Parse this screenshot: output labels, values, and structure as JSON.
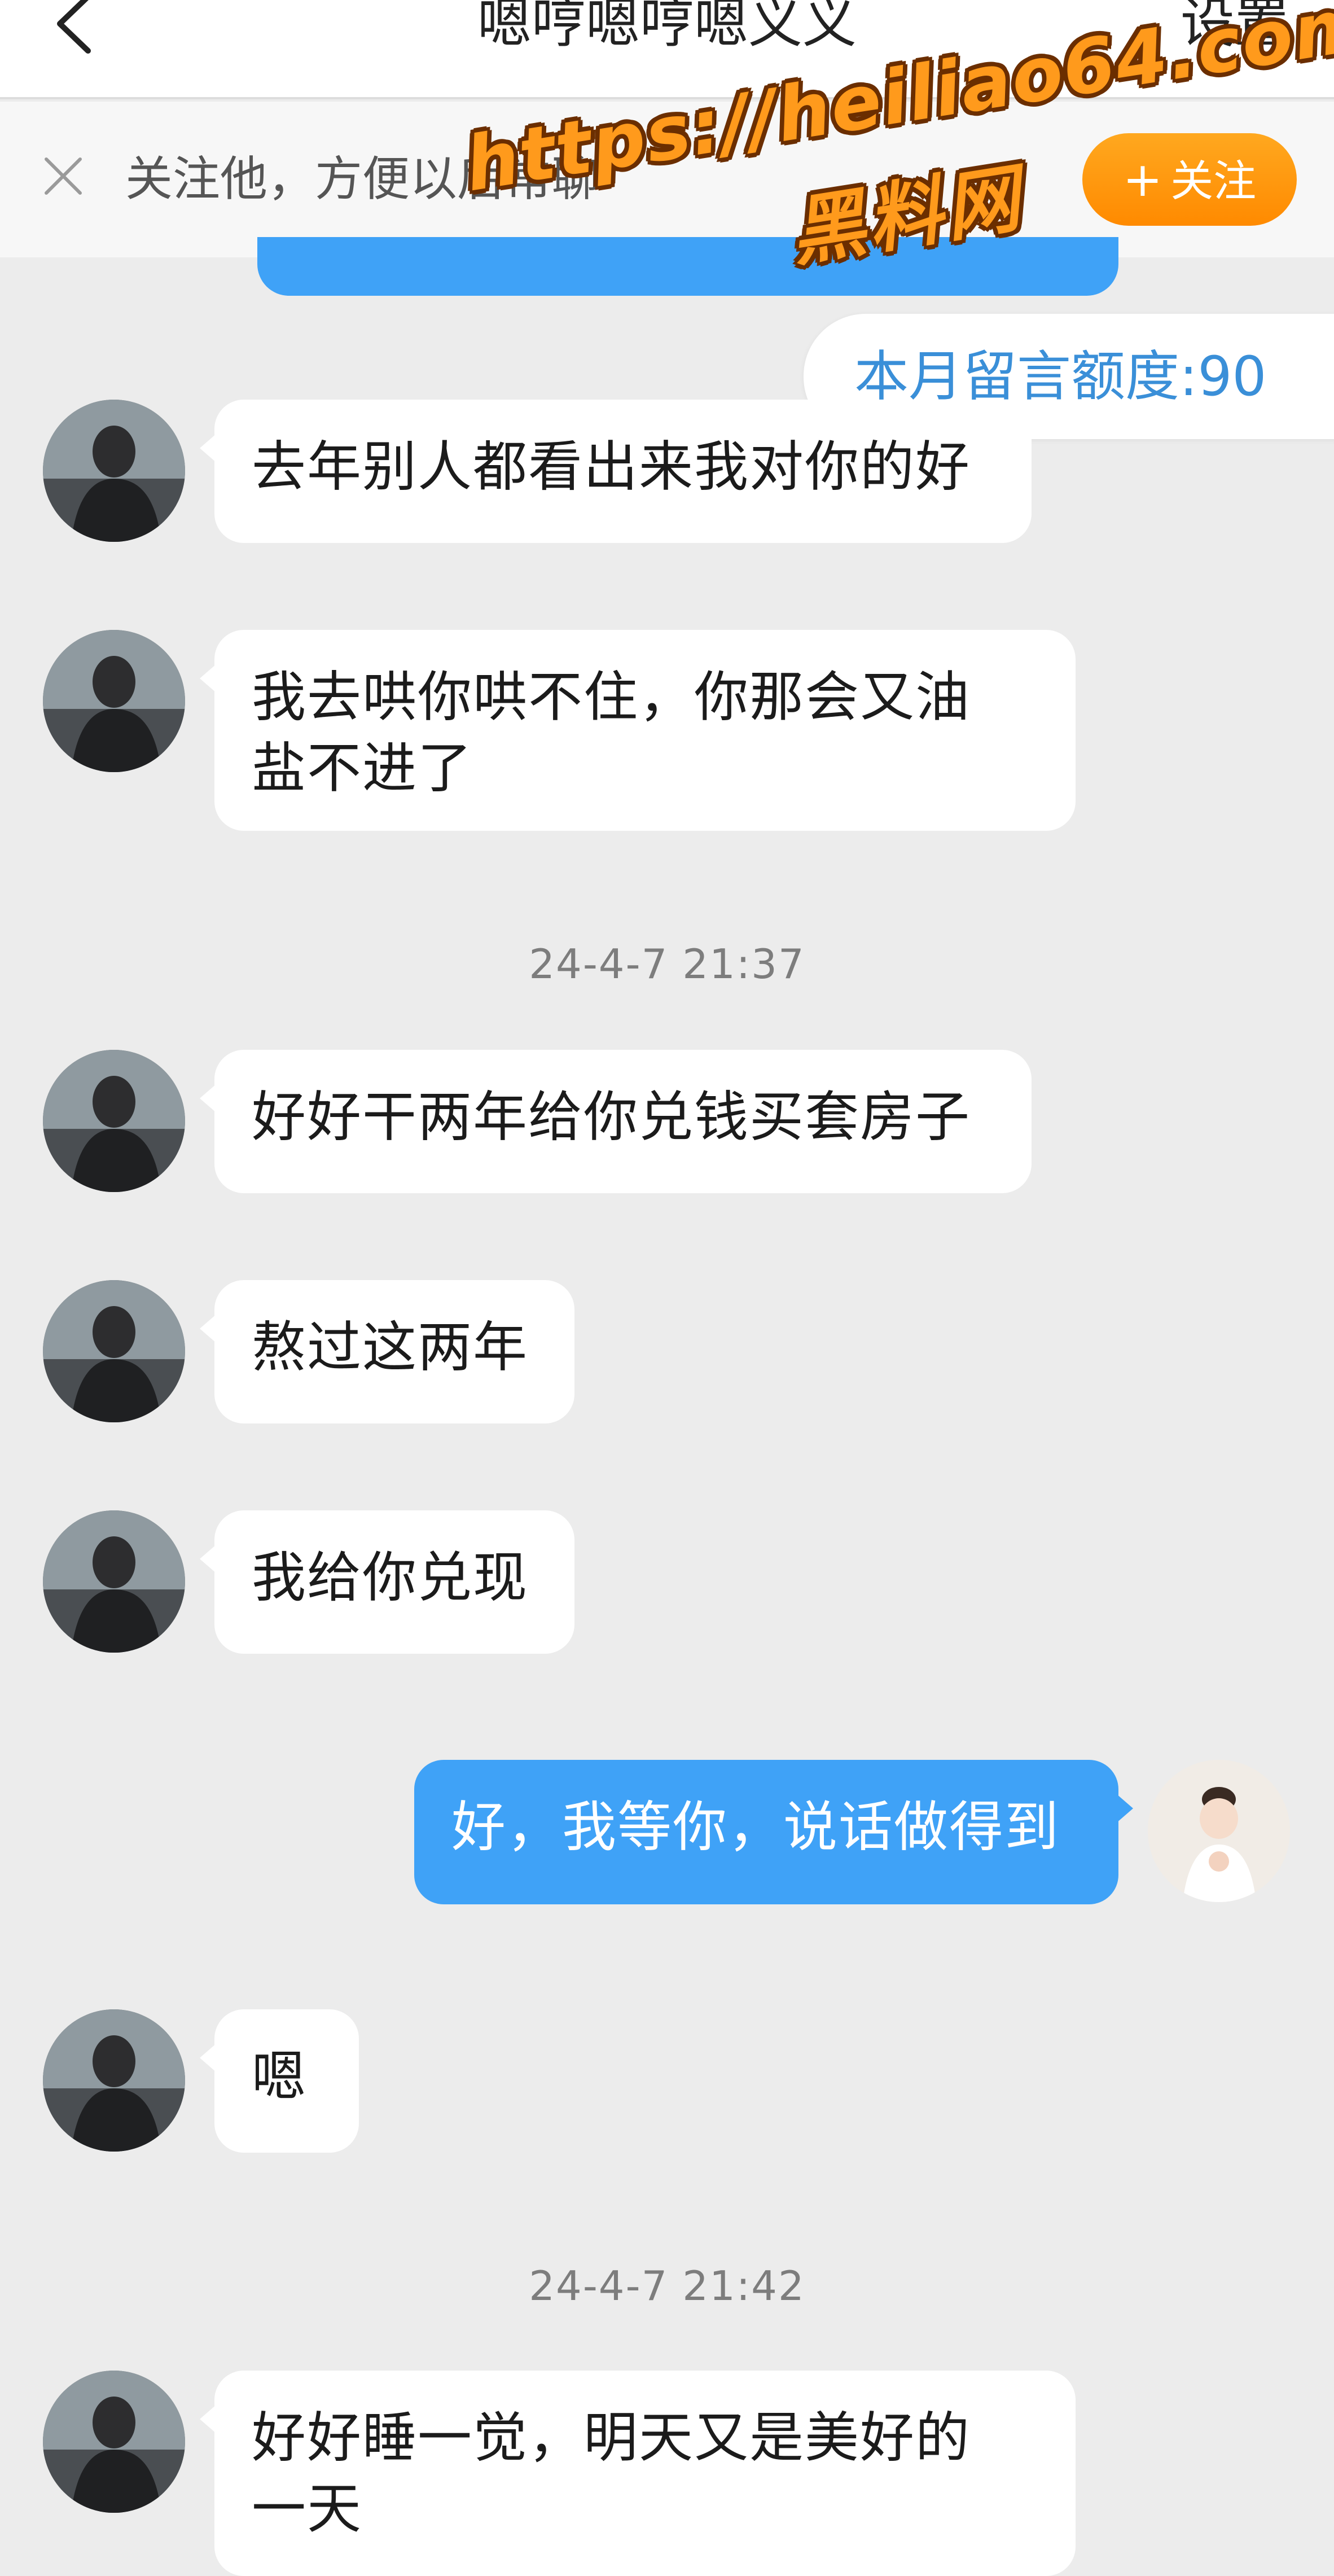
{
  "header": {
    "title": "嗯哼嗯哼嗯义义",
    "settings_label": "设置",
    "back_icon": "chevron-left-icon"
  },
  "follow_bar": {
    "text": "关注他，方便以后常聊",
    "button_label": "关注",
    "button_plus": "+",
    "close_icon": "close-icon"
  },
  "quota": {
    "text": "本月留言额度:90"
  },
  "messages": [
    {
      "side": "left",
      "text": "去年别人都看出来我对你的好"
    },
    {
      "side": "left",
      "line1": "我去哄你哄不住，你那会又油",
      "line2": "盐不进了"
    },
    {
      "type": "time",
      "text": "24-4-7 21:37"
    },
    {
      "side": "left",
      "text": "好好干两年给你兑钱买套房子"
    },
    {
      "side": "left",
      "text": "熬过这两年"
    },
    {
      "side": "left",
      "text": "我给你兑现"
    },
    {
      "side": "right",
      "text": "好，我等你，说话做得到"
    },
    {
      "side": "left",
      "text": "嗯"
    },
    {
      "type": "time",
      "text": "24-4-7 21:42"
    },
    {
      "side": "left",
      "line1": "好好睡一觉，明天又是美好的",
      "line2": "一天"
    }
  ],
  "watermark": {
    "url": "https://heiliao64.com",
    "site": "黑料网"
  },
  "colors": {
    "header_bg": "#ffffff",
    "chat_bg": "#ececec",
    "bubble_left": "#ffffff",
    "bubble_right": "#3fa2f7",
    "follow_button": "#ff9a1c",
    "quota_text": "#3a8fd8",
    "watermark": "#ff9a1c"
  }
}
